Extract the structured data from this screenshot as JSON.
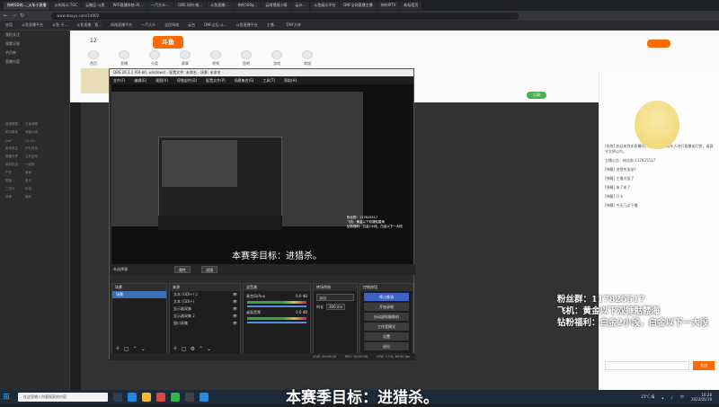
{
  "browser": {
    "tabs": [
      "你的SD的..._火车小直播",
      "火车网斗-TGC",
      "云聚区-斗鱼",
      "WiFi直播系统-AI...",
      "一汽大众-...",
      "OBS 如何-推...",
      "斗鱼直播-...",
      "你的500g...",
      "云雨视频小聊",
      "云计...",
      "斗鱼娱乐平台",
      "DNF全网直播主播",
      "你的IPTV",
      "新标签页"
    ],
    "url": "www.douyu.com/14902",
    "bookmarks": [
      "应用",
      "斗鱼直播平台",
      "斗鱼-不...",
      "斗鱼直播 - 直...",
      "网络直播平台",
      "一汽大众",
      "全民网络",
      "云台",
      "DNF论坛-斗...",
      "斗鱼直播平台",
      "主播...",
      "DNF大神"
    ]
  },
  "left_panel": {
    "items": [
      "我的关注",
      "观看记录",
      "节目单",
      "直播内容"
    ],
    "grid": [
      "英雄联盟",
      "王者荣耀",
      "和平精英",
      "穿越火线",
      "DNF",
      "CS:GO",
      "绝地求生",
      "炉石传说",
      "魔兽世界",
      "主机游戏",
      "单机热游",
      "一起看",
      "户外",
      "美食",
      "颜值",
      "音乐",
      "二次元",
      "科技",
      "体育",
      "娱乐"
    ]
  },
  "site": {
    "logo": "斗鱼",
    "level": "12",
    "nav": [
      "首页",
      "直播",
      "分类",
      "赛事",
      "视频",
      "鱼吧",
      "游戏",
      "商城"
    ],
    "follow_button": "订阅",
    "chat_lines": [
      "[系统] 欢迎来到本直播间，斗鱼严禁未成年人进行直播或打赏，请遵守文明公约。",
      "主播公告：粉丝群 117825517",
      "[弹幕] 进猎杀加油！",
      "[弹幕] 主播太强了",
      "[弹幕] 来了来了",
      "[弹幕] 打卡",
      "[弹幕] 今天几点下播"
    ],
    "chat_button": "发送"
  },
  "obs": {
    "title": "OBS 26.1.1 (64-bit, windows) - 配置文件: 未命名 - 场景: 未命名",
    "menu": [
      "文件(F)",
      "编辑(E)",
      "视图(V)",
      "停靠部件(D)",
      "配置文件(P)",
      "场景集合(S)",
      "工具(T)",
      "帮助(H)"
    ],
    "source_toolbar": [
      "属性",
      "滤镜"
    ],
    "no_source": "未选择源",
    "docks": {
      "scenes_title": "场景",
      "scenes": [
        "场景"
      ],
      "sources_title": "来源",
      "sources": [
        "文本 (GDI+) 2",
        "文本 (GDI+)",
        "显示器采集",
        "显示器采集 2",
        "窗口采集"
      ],
      "mixer_title": "混音器",
      "mixer_channels": [
        {
          "name": "麦克风/Aux",
          "level": "0.0 dB"
        },
        {
          "name": "桌面音频",
          "level": "0.0 dB"
        }
      ],
      "transitions_title": "转场特效",
      "transition": "淡出",
      "duration_label": "时长",
      "duration": "300 ms",
      "controls_title": "控制按钮",
      "controls": [
        "停止推流",
        "开始录制",
        "启动虚拟摄像机",
        "工作室模式",
        "设置",
        "退出"
      ]
    },
    "status": [
      "LIVE: 00:00:00",
      "REC: 00:00:00",
      "CPU: 1.1%, 60.00 fps"
    ]
  },
  "overlays": {
    "season_goal_small": "本赛季目标：进猎杀。",
    "fans_group": "粉丝群：117825517",
    "plane": "飞机：黄金以下双锤骷髅海",
    "diamond": "钻粉福利：白金2小段，白金以下一大段",
    "season_goal": "本赛季目标：进猎杀。"
  },
  "taskbar": {
    "search_placeholder": "在这里输入你要搜索的内容",
    "weather": "23°C 晴",
    "time": "16:28",
    "date": "2022/05/19",
    "lang": "中"
  },
  "colors": {
    "accent": "#ff6a00",
    "obs_blue": "#3d63c6",
    "taskbar": "#1c2a3a"
  }
}
